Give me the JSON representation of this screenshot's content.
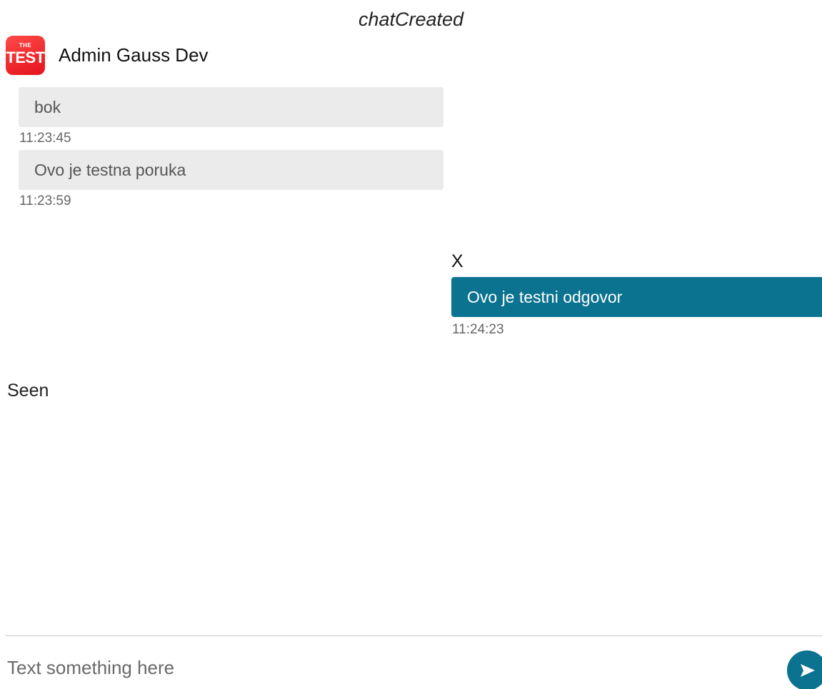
{
  "header": {
    "title": "chatCreated"
  },
  "sender": {
    "logo_top": "THE",
    "logo_bottom": "TEST",
    "name": "Admin Gauss Dev"
  },
  "messages_in": [
    {
      "text": "bok",
      "time": "11:23:45"
    },
    {
      "text": "Ovo je testna poruka",
      "time": "11:23:59"
    }
  ],
  "messages_out": {
    "sender": "X",
    "items": [
      {
        "text": "Ovo je testni odgovor",
        "time": "11:24:23"
      }
    ]
  },
  "status": {
    "seen": "Seen"
  },
  "composer": {
    "placeholder": "Text something here",
    "send_icon": "send-arrow-icon",
    "accent_color": "#0b7290"
  },
  "colors": {
    "incoming_bubble": "#ebebeb",
    "outgoing_bubble": "#0b7290",
    "logo": "#e3141b"
  }
}
